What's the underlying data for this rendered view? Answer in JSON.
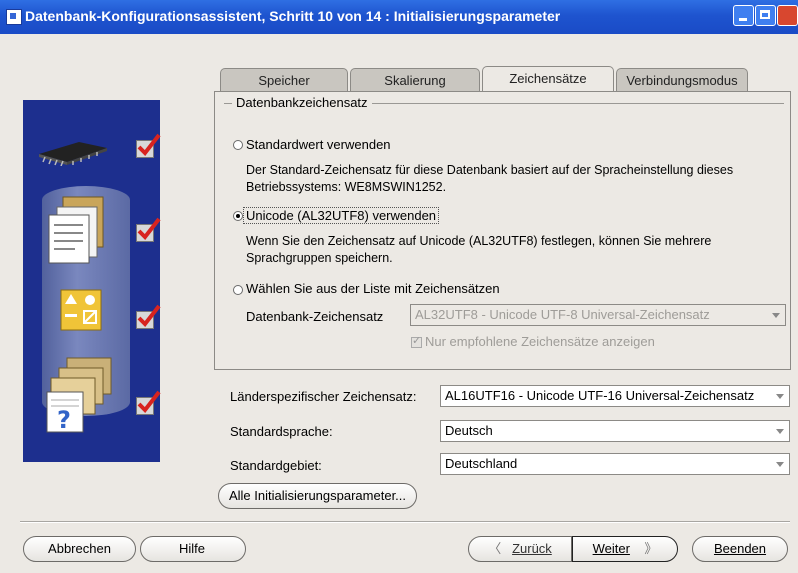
{
  "window": {
    "title": "Datenbank-Konfigurationsassistent, Schritt 10 von 14 : Initialisierungsparameter"
  },
  "sidebar": {
    "icons": [
      "chip-icon",
      "documents-icon",
      "shapes-icon",
      "folders-help-icon"
    ],
    "all_checked": true
  },
  "tabs": [
    {
      "label": "Speicher",
      "active": false
    },
    {
      "label": "Skalierung",
      "active": false
    },
    {
      "label": "Zeichensätze",
      "active": true
    },
    {
      "label": "Verbindungsmodus",
      "active": false
    }
  ],
  "charset_group": {
    "title": "Datenbankzeichensatz",
    "option_default": {
      "label": "Standardwert verwenden",
      "desc": "Der Standard-Zeichensatz für diese Datenbank basiert auf der Spracheinstellung dieses Betriebssystems: WE8MSWIN1252.",
      "selected": false
    },
    "option_unicode": {
      "label": "Unicode (AL32UTF8) verwenden",
      "desc": "Wenn Sie den Zeichensatz auf Unicode (AL32UTF8) festlegen, können Sie mehrere Sprachgruppen speichern.",
      "selected": true
    },
    "option_list": {
      "label": "Wählen Sie aus der Liste mit Zeichensätzen",
      "selected": false
    },
    "db_charset_label": "Datenbank-Zeichensatz",
    "db_charset_value": "AL32UTF8 - Unicode UTF-8 Universal-Zeichensatz",
    "recommended_only_label": "Nur empfohlene Zeichensätze anzeigen",
    "recommended_only_checked": true
  },
  "national_charset": {
    "label": "Länderspezifischer Zeichensatz:",
    "value": "AL16UTF16 - Unicode UTF-16 Universal-Zeichensatz"
  },
  "default_language": {
    "label": "Standardsprache:",
    "value": "Deutsch"
  },
  "default_territory": {
    "label": "Standardgebiet:",
    "value": "Deutschland"
  },
  "buttons": {
    "all_params": "Alle Initialisierungsparameter...",
    "cancel": "Abbrechen",
    "help": "Hilfe",
    "back": "Zurück",
    "next": "Weiter",
    "finish": "Beenden"
  },
  "colors": {
    "titlebar": "#1e54cf",
    "sidebar": "#1d2f8e",
    "background": "#ece9e4"
  }
}
